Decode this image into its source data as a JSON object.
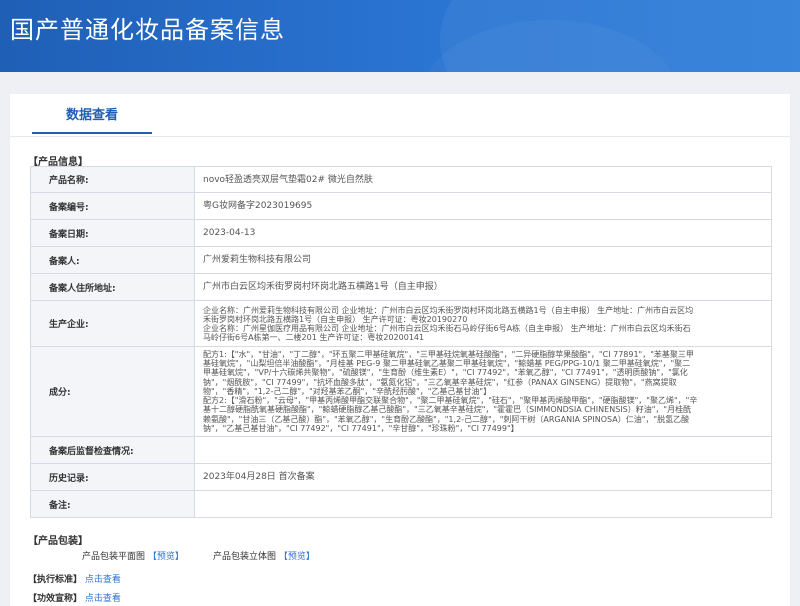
{
  "header": {
    "title": "国产普通化妆品备案信息"
  },
  "tab": {
    "label": "数据查看"
  },
  "product_info": {
    "section_title": "【产品信息】",
    "rows": [
      {
        "label": "产品名称:",
        "value": "novo轻盈透亮双层气垫霜02# 微光自然肤"
      },
      {
        "label": "备案编号:",
        "value": "粤G妆网备字2023019695"
      },
      {
        "label": "备案日期:",
        "value": "2023-04-13"
      },
      {
        "label": "备案人:",
        "value": "广州爱莉生物科技有限公司"
      },
      {
        "label": "备案人住所地址:",
        "value": "广州市白云区均禾街罗岗村环岗北路五横路1号（自主申报）"
      },
      {
        "label": "生产企业:",
        "lines": [
          "企业名称：广州爱莉生物科技有限公司 企业地址：广州市白云区均禾街罗岗村环岗北路五横路1号（自主申报） 生产地址：广州市白云区均",
          "禾街罗岗村环岗北路五横路1号（自主申报） 生产许可证：粤妆20190270",
          "企业名称：广州星伽医疗用品有限公司 企业地址：广州市白云区均禾街石马岭仔街6号A栋（自主申报） 生产地址：广州市白云区均禾街石",
          "马岭仔街6号A栋第一、二楼201 生产许可证：粤妆20200141"
        ]
      },
      {
        "label": "成分:",
        "lines": [
          "配方1:【\"水\"，\"甘油\"，\"丁二醇\"，\"环五聚二甲基硅氧烷\"，\"三甲基硅烷氧基硅酸酯\"，\"二异硬脂醇苹果酸酯\"，\"CI 77891\"，\"苯基聚三甲",
          "基硅氧烷\"，\"山梨坦倍半油酸酯\"，\"月桂基 PEG-9 聚二甲基硅氧乙基聚二甲基硅氧烷\"，\"鲸蜡基 PEG/PPG-10/1 聚二甲基硅氧烷\"，\"聚二",
          "甲基硅氧烷\"，\"VP/十六碳烯共聚物\"，\"硫酸镁\"，\"生育酚（维生素E）\"，\"CI 77492\"，\"苯氧乙醇\"，\"CI 77491\"，\"透明质酸钠\"，\"氯化",
          "钠\"，\"烟酰胺\"，\"CI 77499\"，\"抗坏血酸多肽\"，\"氨氮化铝\"，\"三乙氧基辛基硅烷\"，\"红参（PANAX GINSENG）提取物\"，\"燕窝提取",
          "物\"，\"香精\"，\"1,2-己二醇\"，\"对羟基苯乙酮\"，\"辛酰羟肟酸\"，\"乙基己基甘油\"】",
          "配方2:【\"滑石粉\"，\"云母\"，\"甲基丙烯酸甲酯交联聚合物\"，\"聚二甲基硅氧烷\"，\"硅石\"，\"聚甲基丙烯酸甲酯\"，\"硬脂酸镁\"，\"聚乙烯\"，\"辛",
          "基十二醇硬脂酰氧基硬脂酸酯\"，\"鲸蜡硬脂醇乙基己酸酯\"，\"三乙氧基辛基硅烷\"，\"霍霍巴（SIMMONDSIA CHINENSIS）籽油\"，\"月桂酰",
          "赖氨酸\"，\"甘油三（乙基己酸）酯\"，\"苯氧乙醇\"，\"生育酚乙酸酯\"，\"1,2-己二醇\"，\"刺阿干树（ARGANIA SPINOSA）仁油\"，\"脱氢乙酸",
          "钠\"，\"乙基己基甘油\"，\"CI 77492\"，\"CI 77491\"，\"辛甘醇\"，\"珍珠粉\"，\"CI 77499\"】"
        ]
      },
      {
        "label": "备案后监督检查情况:",
        "value": ""
      },
      {
        "label": "历史记录:",
        "value": "2023年04月28日 首次备案"
      },
      {
        "label": "备注:",
        "value": ""
      }
    ]
  },
  "packaging": {
    "section_title": "【产品包装】",
    "flat_label": "产品包装平面图",
    "flat_link": "【预览】",
    "solid_label": "产品包装立体图",
    "solid_link": "【预览】"
  },
  "standard": {
    "section_title": "【执行标准】",
    "link": "点击查看"
  },
  "efficacy": {
    "section_title": "【功效宣称】",
    "link": "点击查看"
  }
}
